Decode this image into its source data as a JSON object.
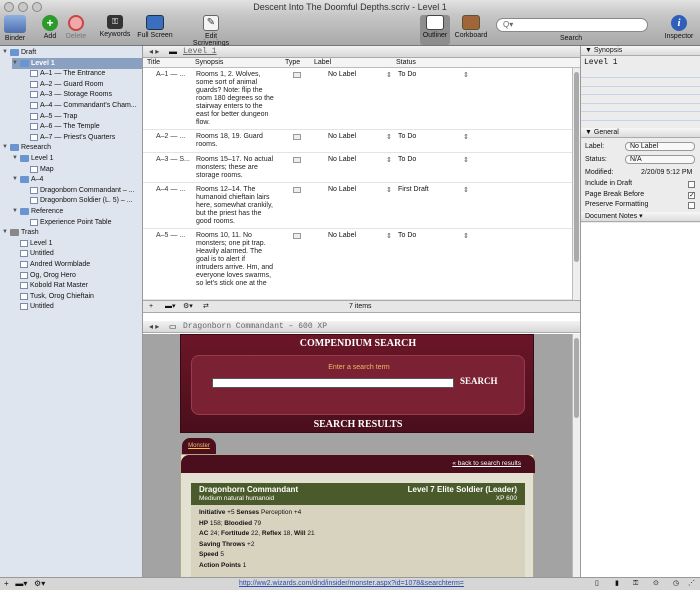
{
  "window_title": "Descent Into The Doomful Depths.scriv - Level 1",
  "toolbar": {
    "binder": "Binder",
    "add": "Add",
    "delete": "Delete",
    "keywords": "Keywords",
    "full_screen": "Full Screen",
    "edit_scrivenings": "Edit Scrivenings",
    "outliner": "Outliner",
    "corkboard": "Corkboard",
    "search_label": "Search",
    "search_placeholder": "Q▾",
    "inspector": "Inspector"
  },
  "binder": [
    {
      "label": "Draft",
      "indent": 0,
      "kind": "draft",
      "tri": "▼"
    },
    {
      "label": "Level 1",
      "indent": 1,
      "kind": "folder",
      "tri": "▼",
      "selected": true
    },
    {
      "label": "A–1 — The Entrance",
      "indent": 2,
      "kind": "file"
    },
    {
      "label": "A–2 — Guard Room",
      "indent": 2,
      "kind": "file"
    },
    {
      "label": "A–3 — Storage Rooms",
      "indent": 2,
      "kind": "file"
    },
    {
      "label": "A–4 — Commandant's Cham...",
      "indent": 2,
      "kind": "file"
    },
    {
      "label": "A–5 — Trap",
      "indent": 2,
      "kind": "file"
    },
    {
      "label": "A–6 — The Temple",
      "indent": 2,
      "kind": "file"
    },
    {
      "label": "A–7 — Priest's Quarters",
      "indent": 2,
      "kind": "file"
    },
    {
      "label": "Research",
      "indent": 0,
      "kind": "folder",
      "tri": "▼"
    },
    {
      "label": "Level 1",
      "indent": 1,
      "kind": "folder",
      "tri": "▼"
    },
    {
      "label": "Map",
      "indent": 2,
      "kind": "file"
    },
    {
      "label": "A–4",
      "indent": 1,
      "kind": "folder",
      "tri": "▼"
    },
    {
      "label": "Dragonborn Commandant – ...",
      "indent": 2,
      "kind": "file"
    },
    {
      "label": "Dragonborn Soldier (L. 5) – ...",
      "indent": 2,
      "kind": "file"
    },
    {
      "label": "Reference",
      "indent": 1,
      "kind": "folder",
      "tri": "▼"
    },
    {
      "label": "Experience Point Table",
      "indent": 2,
      "kind": "file"
    },
    {
      "label": "Trash",
      "indent": 0,
      "kind": "trash",
      "tri": "▼"
    },
    {
      "label": "Level 1",
      "indent": 1,
      "kind": "file"
    },
    {
      "label": "Untitled",
      "indent": 1,
      "kind": "file"
    },
    {
      "label": "Andred Wormblade",
      "indent": 1,
      "kind": "file"
    },
    {
      "label": "Og, Orog Hero",
      "indent": 1,
      "kind": "file"
    },
    {
      "label": "Kobold Rat Master",
      "indent": 1,
      "kind": "file"
    },
    {
      "label": "Tusk, Orog Chieftain",
      "indent": 1,
      "kind": "file"
    },
    {
      "label": "Untitled",
      "indent": 1,
      "kind": "file"
    }
  ],
  "outliner": {
    "header_title": "Level 1",
    "columns": {
      "title": "Title",
      "synopsis": "Synopsis",
      "type": "Type",
      "label": "Label",
      "status": "Status"
    },
    "rows": [
      {
        "title": "A–1 — ...",
        "synopsis": [
          "Rooms 1, 2. Wolves,",
          "some sort of animal",
          "guards? Note: flip the",
          "room 180 degrees so the",
          "stairway enters to the",
          "east for better dungeon",
          "flow."
        ],
        "label": "No Label",
        "status": "To Do"
      },
      {
        "title": "A–2 — ...",
        "synopsis": [
          "Rooms 18, 19. Guard",
          "rooms."
        ],
        "label": "No Label",
        "status": "To Do"
      },
      {
        "title": "A–3 — S...",
        "synopsis": [
          "Rooms 15–17. No actual",
          "monsters; these are",
          "storage rooms."
        ],
        "label": "No Label",
        "status": "To Do"
      },
      {
        "title": "A–4 — ...",
        "synopsis": [
          "Rooms 12–14. The",
          "humanoid chieftain lairs",
          "here, somewhat crankily,",
          "but the priest has the",
          "good rooms."
        ],
        "label": "No Label",
        "status": "First Draft"
      },
      {
        "title": "A–5 — ...",
        "synopsis": [
          "Rooms 10, 11. No",
          "monsters; one pit trap.",
          "Heavily alarmed. The",
          "goal is to alert if",
          "intruders arrive. Hm, and",
          "everyone loves swarms,",
          "so let's stick one at the"
        ],
        "label": "No Label",
        "status": "To Do"
      }
    ],
    "item_count": "7 items"
  },
  "lower_editor": {
    "header_title": "Dragonborn Commandant – 600 XP",
    "compendium_title": "COMPENDIUM SEARCH",
    "enter_term": "Enter a search term",
    "search_button": "SEARCH",
    "results_title": "SEARCH RESULTS",
    "monster_tab": "Monster",
    "back_link": "« back to search results",
    "monster_name": "Dragonborn Commandant",
    "monster_type": "Medium natural humanoid",
    "monster_level": "Level 7 Elite Soldier (Leader)",
    "monster_xp": "XP 600",
    "stats": [
      {
        "k": "Initiative",
        "v": " +5 ",
        "k2": "Senses",
        "v2": " Perception +4"
      },
      {
        "k": "HP",
        "v": " 158; ",
        "k2": "Bloodied",
        "v2": " 79"
      },
      {
        "k": "AC",
        "v": " 24; ",
        "k2": "Fortitude",
        "v2": " 22, ",
        "k3": "Reflex",
        "v3": " 18, ",
        "k4": "Will",
        "v4": " 21"
      },
      {
        "k": "Saving Throws",
        "v": " +2"
      },
      {
        "k": "Speed",
        "v": " 5"
      },
      {
        "k": "Action Points",
        "v": " 1"
      }
    ],
    "url": "http://ww2.wizards.com/dnd/insider/monster.aspx?id=1078&searchterm="
  },
  "inspector": {
    "synopsis_header": "Synopsis",
    "synopsis_title": "Level 1",
    "general_header": "General",
    "label_label": "Label:",
    "label_value": "No Label",
    "status_label": "Status:",
    "status_value": "N/A",
    "modified_label": "Modified:",
    "modified_value": "2/20/09 5:12 PM",
    "include_in_draft": "Include in Draft",
    "page_break_before": "Page Break Before",
    "page_break_checked": "✓",
    "preserve_formatting": "Preserve Formatting",
    "document_notes": "Document Notes"
  }
}
